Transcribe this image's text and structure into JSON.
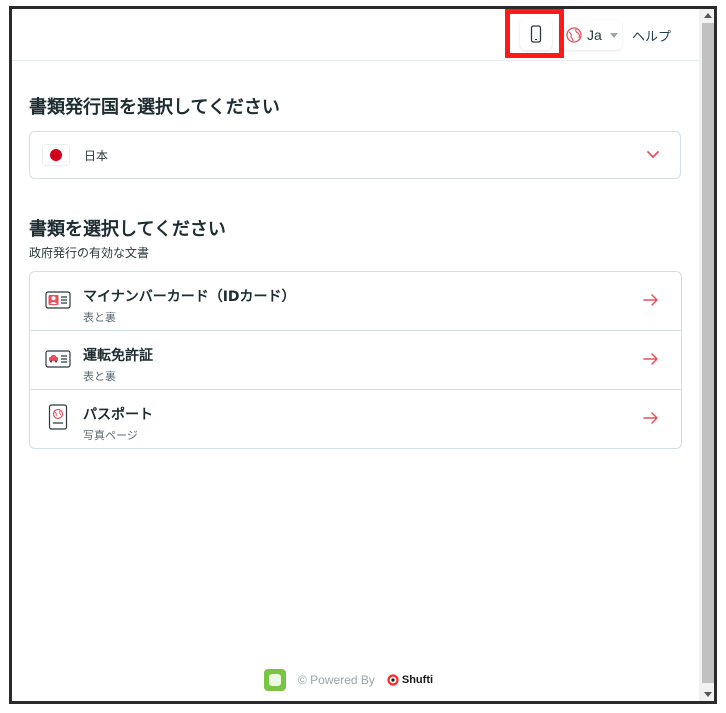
{
  "header": {
    "language": "Ja",
    "help_label": "ヘルプ"
  },
  "country_section": {
    "title": "書類発行国を選択してください",
    "selected_country": "日本"
  },
  "document_section": {
    "title": "書類を選択してください",
    "subtitle": "政府発行の有効な文書",
    "documents": [
      {
        "label": "マイナンバーカード（IDカード）",
        "sub": "表と裏"
      },
      {
        "label": "運転免許証",
        "sub": "表と裏"
      },
      {
        "label": "パスポート",
        "sub": "写真ページ"
      }
    ]
  },
  "footer": {
    "powered_by": "© Powered By",
    "brand": "Shufti"
  },
  "colors": {
    "accent_red": "#e8505b",
    "highlight": "#ff1a1a",
    "border": "#d3e0e6",
    "footer_green": "#79c442"
  }
}
